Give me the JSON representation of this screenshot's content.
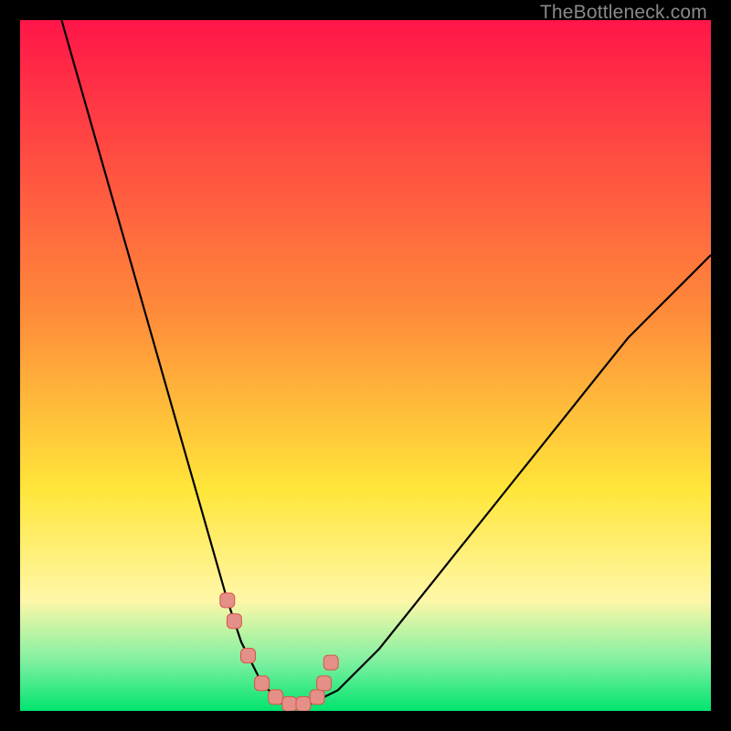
{
  "watermark": "TheBottleneck.com",
  "colors": {
    "black": "#000000",
    "curve": "#000000",
    "marker_fill": "#e48f88",
    "marker_stroke": "#d6564a",
    "grad_top": "#ff1649",
    "grad_mid1": "#ff8a3a",
    "grad_mid2": "#ffe63a",
    "grad_low1": "#fff7a8",
    "grad_low2": "#7cf0a0",
    "grad_bottom": "#00e46f"
  },
  "chart_data": {
    "type": "line",
    "title": "",
    "xlabel": "",
    "ylabel": "",
    "xlim": [
      0,
      100
    ],
    "ylim": [
      0,
      100
    ],
    "series": [
      {
        "name": "bottleneck-curve",
        "x": [
          6,
          8,
          10,
          12,
          14,
          16,
          18,
          20,
          22,
          24,
          26,
          28,
          30,
          31,
          32,
          33,
          34,
          35,
          36,
          37,
          38,
          39,
          40,
          42,
          44,
          46,
          48,
          52,
          56,
          60,
          64,
          68,
          72,
          76,
          80,
          84,
          88,
          92,
          96,
          100
        ],
        "y": [
          100,
          93,
          86,
          79,
          72,
          65,
          58,
          51,
          44,
          37,
          30,
          23,
          16,
          13,
          10,
          8,
          6,
          4,
          3,
          2,
          1,
          1,
          1,
          1,
          2,
          3,
          5,
          9,
          14,
          19,
          24,
          29,
          34,
          39,
          44,
          49,
          54,
          58,
          62,
          66
        ]
      }
    ],
    "markers": {
      "name": "highlighted-points",
      "x": [
        30,
        31,
        33,
        35,
        37,
        39,
        41,
        43,
        44,
        45
      ],
      "y": [
        16,
        13,
        8,
        4,
        2,
        1,
        1,
        2,
        4,
        7
      ]
    }
  }
}
